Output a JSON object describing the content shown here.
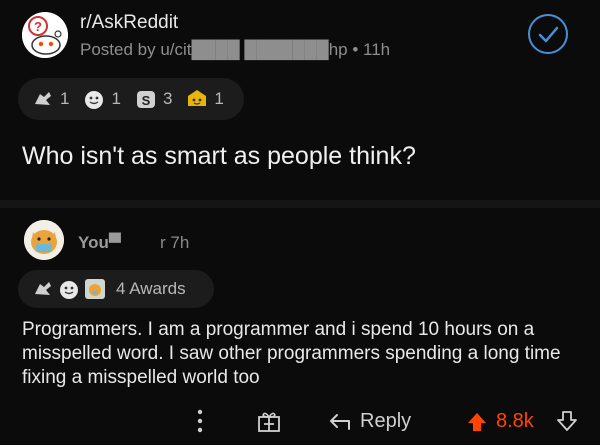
{
  "post": {
    "subreddit": "r/AskReddit",
    "posted_by": "Posted by u/cit████ ███████hp • 11h",
    "awards": [
      {
        "icon": "silver-award-icon",
        "count": "1"
      },
      {
        "icon": "wholesome-award-icon",
        "count": "1"
      },
      {
        "icon": "helpful-award-icon",
        "count": "3"
      },
      {
        "icon": "gold-award-icon",
        "count": "1"
      }
    ],
    "title": "Who isn't as smart as people think?"
  },
  "comment": {
    "username": "You▀",
    "time": "r 7h",
    "awards_label": "4 Awards",
    "body": "Programmers. I am a programmer and i spend 10 hours on a misspelled word. I saw other programmers spending a long time fixing a misspelled world too",
    "actions": {
      "reply": "Reply",
      "score": "8.8k"
    }
  },
  "colors": {
    "background": "#0b0b0b",
    "accent_blue": "#4a90d9",
    "upvote": "#ff4500"
  }
}
